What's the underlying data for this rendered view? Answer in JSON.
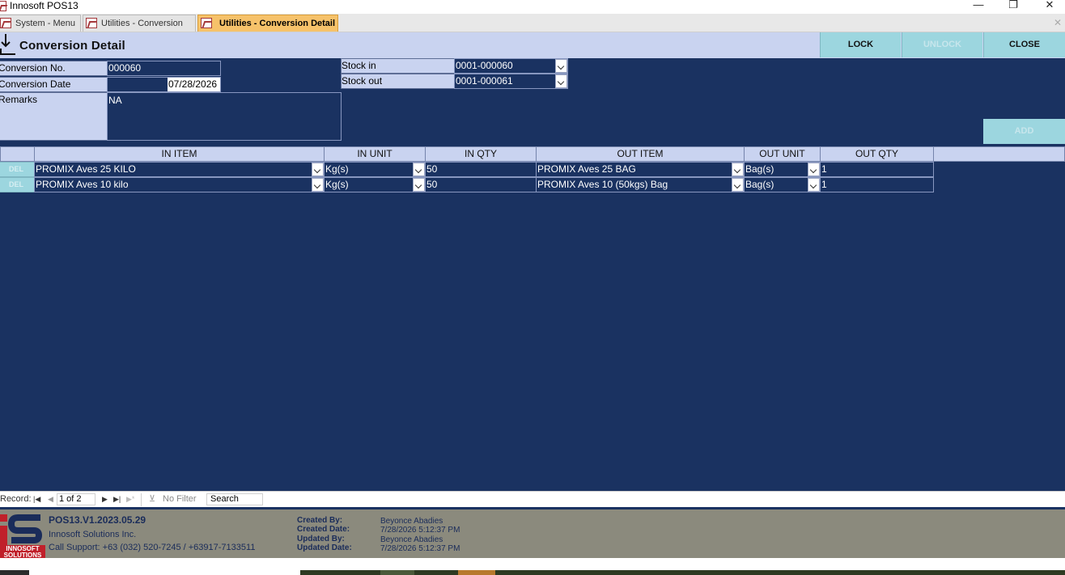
{
  "window": {
    "title": "Innosoft POS13",
    "minimize": "—",
    "restore": "❐",
    "close": "✕"
  },
  "tabs": [
    {
      "label": "System - Menu"
    },
    {
      "label": "Utilities - Conversion"
    },
    {
      "label": "Utilities - Conversion Detail"
    }
  ],
  "tab_close": "✕",
  "header": {
    "title": "Conversion  Detail",
    "lock_label": "LOCK",
    "unlock_label": "UNLOCK",
    "close_label": "CLOSE"
  },
  "form": {
    "conversion_no_label": "Conversion No.",
    "conversion_no": "000060",
    "conversion_date_label": "Conversion Date",
    "conversion_date": "07/28/2026",
    "remarks_label": "Remarks",
    "remarks": "NA",
    "stock_in_label": "Stock in",
    "stock_in": "0001-000060",
    "stock_out_label": "Stock out",
    "stock_out": "0001-000061",
    "add_label": "ADD"
  },
  "grid": {
    "columns": [
      "IN ITEM",
      "IN UNIT",
      "IN QTY",
      "OUT ITEM",
      "OUT UNIT",
      "OUT QTY"
    ],
    "del_label": "DEL",
    "rows": [
      {
        "in_item": "PROMIX Aves 25 KILO",
        "in_unit": "Kg(s)",
        "in_qty": "50",
        "out_item": "PROMIX Aves 25 BAG",
        "out_unit": "Bag(s)",
        "out_qty": "1"
      },
      {
        "in_item": "PROMIX Aves 10 kilo",
        "in_unit": "Kg(s)",
        "in_qty": "50",
        "out_item": "PROMIX Aves 10 (50kgs) Bag",
        "out_unit": "Bag(s)",
        "out_qty": "1"
      }
    ]
  },
  "record_nav": {
    "label": "Record:",
    "position": "1 of 2",
    "filter": "No Filter",
    "search": "Search"
  },
  "footer": {
    "logo_text": "INNOSOFT SOLUTIONS",
    "version": "POS13.V1.2023.05.29",
    "company": "Innosoft Solutions Inc.",
    "support": "Call Support: +63 (032) 520-7245 / +63917-7133511",
    "created_by_label": "Created By:",
    "created_by": "Beyonce Abadies",
    "created_date_label": "Created Date:",
    "created_date": "7/28/2026 5:12:37 PM",
    "updated_by_label": "Updated By:",
    "updated_by": "Beyonce Abadies",
    "updated_date_label": "Updated Date:",
    "updated_date": "7/28/2026 5:12:37 PM"
  },
  "colors": {
    "form_background": "#1a3261",
    "label_background": "#c9d3f0",
    "button_background": "#9cd6df",
    "active_tab": "#f6c26a",
    "footer_background": "#8b8a7d",
    "logo_red": "#c0202a"
  }
}
